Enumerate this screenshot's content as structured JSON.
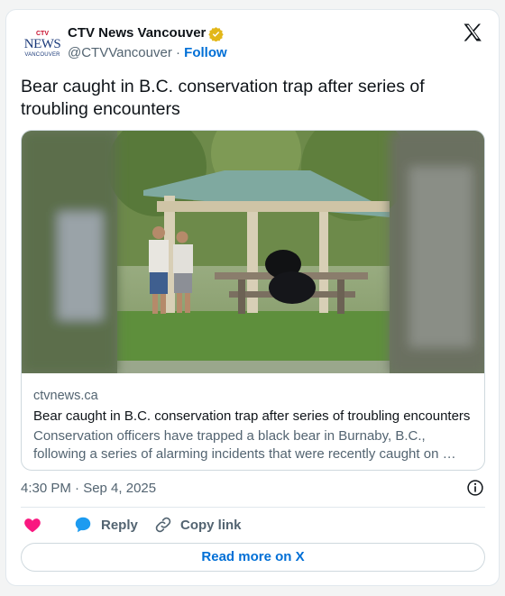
{
  "account": {
    "logo_mark": "CTV",
    "logo_news": "NEWS",
    "logo_city": "VANCOUVER",
    "name": "CTV News Vancouver",
    "handle": "@CTVVancouver",
    "separator": " · ",
    "follow_label": "Follow",
    "verified_color": "#e2b719"
  },
  "tweet": {
    "text": "Bear caught in B.C. conservation trap after series of troubling encounters"
  },
  "link_card": {
    "domain": "ctvnews.ca",
    "title": "Bear caught in B.C. conservation trap after series of troubling encounters",
    "description": "Conservation officers have trapped a black bear in Burnaby, B.C., following a series of alarming incidents that were recently caught on …"
  },
  "meta": {
    "timestamp": "4:30 PM · Sep 4, 2025"
  },
  "actions": {
    "like_label": "",
    "reply_label": "Reply",
    "copy_label": "Copy link",
    "read_more_label": "Read more on X"
  },
  "colors": {
    "accent": "#006fd6",
    "like": "#f91880",
    "reply": "#1d9bf0",
    "muted": "#536471"
  },
  "icons": [
    "verified-badge-icon",
    "x-logo-icon",
    "info-icon",
    "heart-icon",
    "reply-bubble-icon",
    "link-icon"
  ]
}
